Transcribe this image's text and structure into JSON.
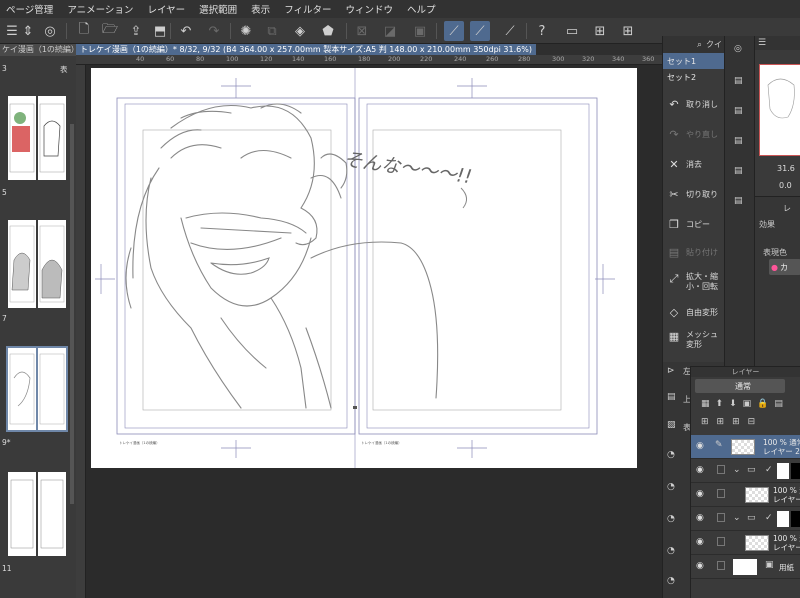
{
  "menu": [
    "ページ管理",
    "アニメーション",
    "レイヤー",
    "選択範囲",
    "表示",
    "フィルター",
    "ウィンドウ",
    "ヘルプ"
  ],
  "document": {
    "tab_title": "トレケイ漫画（1の続編）* 8/32, 9/32 (B4 364.00 x 257.00mm 製本サイズ:A5 判 148.00 x 210.00mm 350dpi 31.6%)",
    "ruler_ticks": [
      "40",
      "60",
      "80",
      "100",
      "120",
      "140",
      "160",
      "180",
      "200",
      "220",
      "240",
      "260",
      "280",
      "300",
      "320",
      "340",
      "360"
    ],
    "page_footer_left": "トレケイ漫画（1の続編）",
    "page_footer_right": "トレケイ漫画（1の続編）",
    "sketch_text": "そんな〜〜〜!!"
  },
  "left_panel": {
    "header": "ケイ漫画（1の続編）",
    "header_right": "表",
    "page_numbers": [
      "3",
      "5",
      "7",
      "9*",
      "11"
    ]
  },
  "sets": {
    "search_label": "クイ",
    "items": [
      "セット1",
      "セット2"
    ]
  },
  "commands": [
    {
      "label": "取り消し",
      "icon": "↶",
      "enabled": true
    },
    {
      "label": "やり直し",
      "icon": "↷",
      "enabled": false
    },
    {
      "label": "消去",
      "icon": "✕",
      "enabled": true
    },
    {
      "label": "切り取り",
      "icon": "✂",
      "enabled": true
    },
    {
      "label": "コピー",
      "icon": "❐",
      "enabled": true
    },
    {
      "label": "貼り付け",
      "icon": "▤",
      "enabled": false
    },
    {
      "label": "拡大・縮小・回転",
      "icon": "⤢",
      "enabled": true
    },
    {
      "label": "自由変形",
      "icon": "◇",
      "enabled": true
    },
    {
      "label": "メッシュ変形",
      "icon": "▦",
      "enabled": true
    }
  ],
  "navigator": {
    "zoom": "31.6",
    "rotation": "0.0"
  },
  "property": {
    "label_re": "レ",
    "effect": "効果",
    "color_label": "表現色",
    "color_value": "カ"
  },
  "layers": {
    "title": "レイヤー",
    "blend_mode": "通常",
    "rows": [
      {
        "line1": "100 % 通常",
        "line2": "レイヤー 2",
        "selected": true
      },
      {
        "line1": "",
        "line2": "",
        "selected": false
      },
      {
        "line1": "100 % 通",
        "line2": "レイヤー",
        "selected": false
      },
      {
        "line1": "",
        "line2": "",
        "selected": false
      },
      {
        "line1": "100 % 通",
        "line2": "レイヤー",
        "selected": false
      },
      {
        "line1": "用紙",
        "line2": "",
        "selected": false
      }
    ]
  },
  "sub_tools": {
    "left_label_a": "左",
    "left_label_b": "上",
    "left_label_c": "表"
  }
}
